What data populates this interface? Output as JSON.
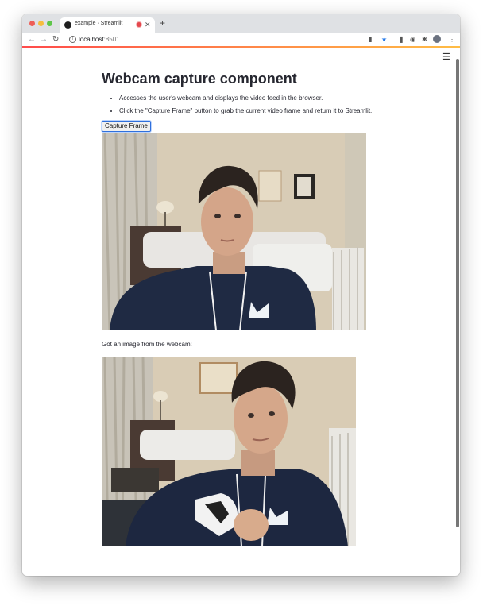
{
  "browser": {
    "tab_title": "example · Streamlit",
    "new_tab_label": "+",
    "close_label": "✕",
    "url_host": "localhost",
    "url_port": ":8501"
  },
  "page": {
    "title": "Webcam capture component",
    "bullets": [
      "Accesses the user's webcam and displays the video feed in the browser.",
      "Click the \"Capture Frame\" button to grab the current video frame and return it to Streamlit."
    ],
    "capture_button_label": "Capture Frame",
    "result_label": "Got an image from the webcam:"
  },
  "colors": {
    "accent_red": "#ff4b4b",
    "accent_yellow": "#ffbd45",
    "focus_blue": "#2f6fdc",
    "text": "#262730"
  },
  "icons": {
    "back": "arrow-left-icon",
    "forward": "arrow-right-icon",
    "reload": "reload-icon",
    "info": "info-icon",
    "camera": "camera-icon",
    "bookmark": "star-icon",
    "extensions": "puzzle-icon",
    "menu": "hamburger-menu-icon"
  }
}
